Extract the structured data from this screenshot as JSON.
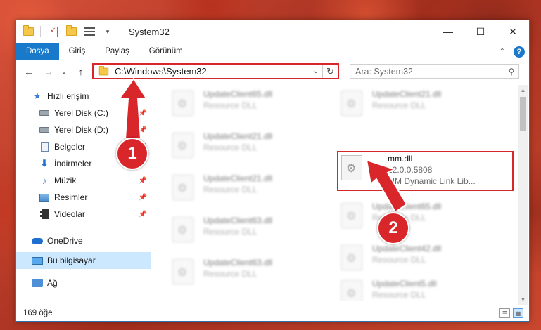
{
  "window": {
    "title": "System32",
    "controls": {
      "minimize": "—",
      "maximize": "☐",
      "close": "✕"
    }
  },
  "ribbon": {
    "tabs": [
      {
        "label": "Dosya"
      },
      {
        "label": "Giriş"
      },
      {
        "label": "Paylaş"
      },
      {
        "label": "Görünüm"
      }
    ],
    "help": "?"
  },
  "nav": {
    "back": "←",
    "forward": "→",
    "recent": "⌄",
    "up": "↑",
    "address": "C:\\Windows\\System32",
    "refresh": "↻",
    "search_placeholder": "Ara: System32"
  },
  "sidebar": {
    "quick_access": "Hızlı erişim",
    "items": [
      {
        "label": "Yerel Disk (C:)",
        "icon": "disk-icon"
      },
      {
        "label": "Yerel Disk (D:)",
        "icon": "disk-icon"
      },
      {
        "label": "Belgeler",
        "icon": "documents-icon"
      },
      {
        "label": "İndirmeler",
        "icon": "downloads-icon"
      },
      {
        "label": "Müzik",
        "icon": "music-icon"
      },
      {
        "label": "Resimler",
        "icon": "pictures-icon"
      },
      {
        "label": "Videolar",
        "icon": "videos-icon"
      }
    ],
    "onedrive": "OneDrive",
    "this_pc": "Bu bilgisayar",
    "network": "Ağ"
  },
  "files": {
    "left": [
      {
        "name": "UpdateClient65.dll",
        "desc": "Resource DLL"
      },
      {
        "name": "UpdateClient21.dll",
        "desc": "Resource DLL"
      },
      {
        "name": "UpdateClient21.dll",
        "desc": "Resource DLL"
      },
      {
        "name": "UpdateClient63.dll",
        "desc": "Resource DLL"
      },
      {
        "name": "UpdateClient63.dll",
        "desc": "Resource DLL"
      }
    ],
    "right": [
      {
        "name": "UpdateClient21.dll",
        "desc": "Resource DLL"
      },
      {
        "name": "mm.dll",
        "desc": "12.0.0.5808",
        "desc2": "MM Dynamic Link Lib..."
      },
      {
        "name": "UpdateClient65.dll",
        "desc": "Resource DLL"
      },
      {
        "name": "UpdateClient42.dll",
        "desc": "Resource DLL"
      },
      {
        "name": "UpdateClient5.dll",
        "desc": "Resource DLL"
      }
    ]
  },
  "status": {
    "count": "169 öğe"
  },
  "annotations": {
    "badge1": "1",
    "badge2": "2",
    "color": "#d9262a"
  }
}
